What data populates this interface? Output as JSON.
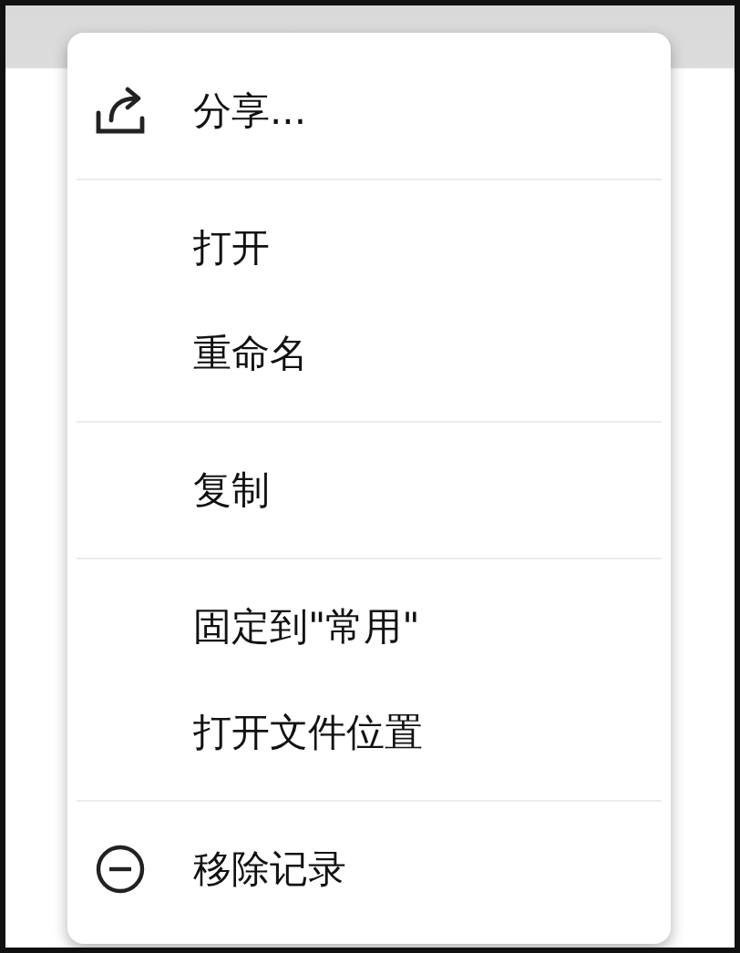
{
  "menu": {
    "groups": [
      {
        "items": [
          {
            "kind": "share",
            "label": "分享..."
          }
        ]
      },
      {
        "items": [
          {
            "kind": "text",
            "label": "打开"
          },
          {
            "kind": "text",
            "label": "重命名"
          }
        ]
      },
      {
        "items": [
          {
            "kind": "text",
            "label": "复制"
          }
        ]
      },
      {
        "items": [
          {
            "kind": "text",
            "label": "固定到\"常用\""
          },
          {
            "kind": "text",
            "label": "打开文件位置"
          }
        ]
      },
      {
        "items": [
          {
            "kind": "remove",
            "label": "移除记录"
          }
        ]
      }
    ]
  }
}
